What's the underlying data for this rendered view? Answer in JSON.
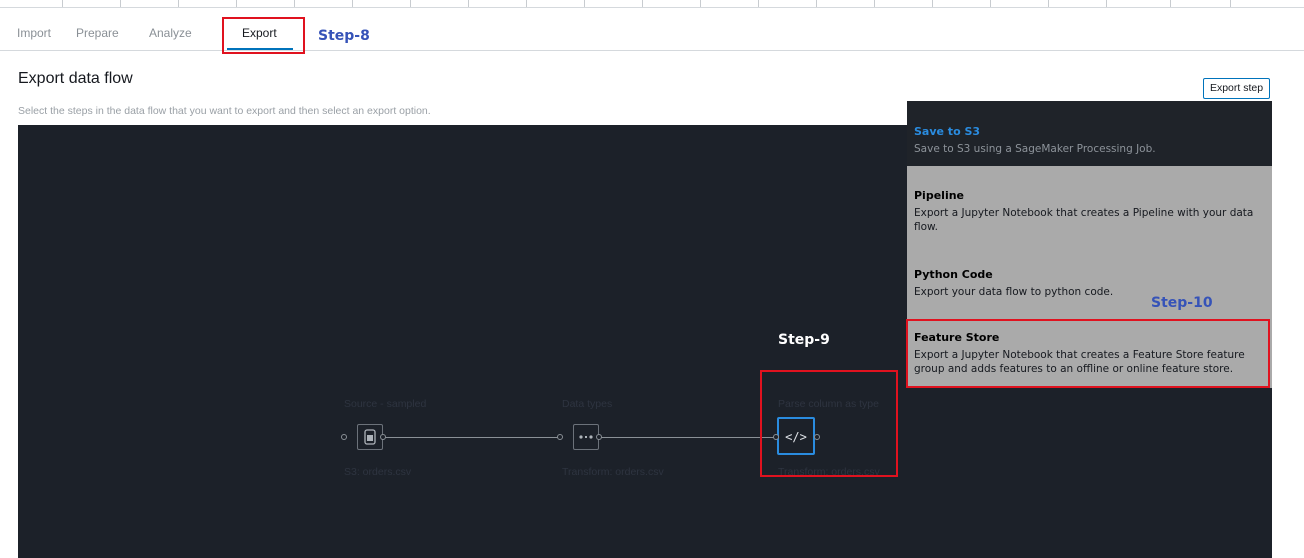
{
  "tabs": [
    {
      "label": "Import"
    },
    {
      "label": "Prepare"
    },
    {
      "label": "Analyze"
    },
    {
      "label": "Export",
      "active": true
    }
  ],
  "annotations": {
    "step8": "Step-8",
    "step9": "Step-9",
    "step10": "Step-10"
  },
  "page": {
    "title": "Export data flow",
    "subtitle": "Select the steps in the data flow that you want to export and then select an export option.",
    "export_button": "Export step"
  },
  "export_options": [
    {
      "title": "Save to S3",
      "description": "Save to S3 using a SageMaker Processing Job."
    },
    {
      "title": "Pipeline",
      "description": "Export a Jupyter Notebook that creates a Pipeline with your data flow."
    },
    {
      "title": "Python Code",
      "description": "Export your data flow to python code."
    },
    {
      "title": "Feature Store",
      "description": "Export a Jupyter Notebook that creates a Feature Store feature group and adds features to an offline or online feature store."
    }
  ],
  "flow_nodes": [
    {
      "label": "Source - sampled",
      "sublabel": "S3: orders.csv",
      "icon": "database-icon"
    },
    {
      "label": "Data types",
      "sublabel": "Transform: orders.csv",
      "icon": "data-types-icon",
      "icon_text": "#.#"
    },
    {
      "label": "Parse column as type",
      "sublabel": "Transform: orders.csv",
      "icon": "code-icon",
      "icon_text": "</>",
      "selected": true
    }
  ],
  "colors": {
    "accent": "#0073bb",
    "highlight": "#e0121f",
    "annotation": "#3653b8",
    "canvas": "#1c2129"
  }
}
